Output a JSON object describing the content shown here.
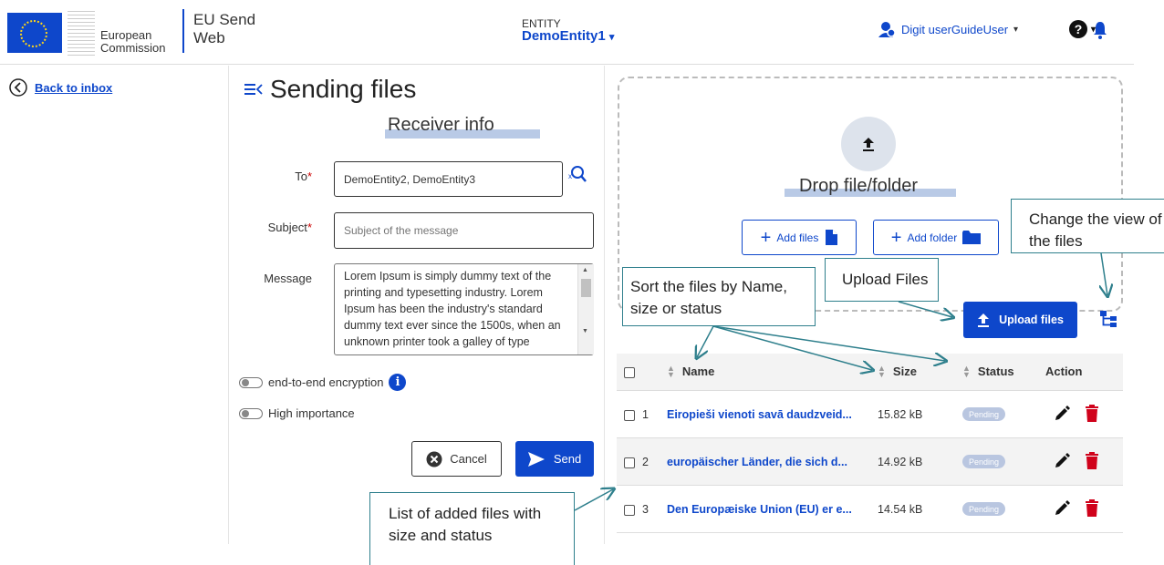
{
  "header": {
    "org_line1": "European",
    "org_line2": "Commission",
    "app_line1": "EU Send",
    "app_line2": "Web",
    "entity_label": "ENTITY",
    "entity_name": "DemoEntity1",
    "user_name": "Digit userGuideUser",
    "help_label": "?"
  },
  "nav": {
    "back_label": "Back to inbox"
  },
  "form": {
    "title": "Sending files",
    "section_title": "Receiver info",
    "to_label": "To",
    "to_value": "DemoEntity2, DemoEntity3",
    "subject_label": "Subject",
    "subject_placeholder": "Subject of the message",
    "message_label": "Message",
    "message_value": "Lorem Ipsum is simply dummy text of the printing and typesetting industry. Lorem Ipsum has been the industry's standard dummy text ever since the 1500s, when an unknown printer took a galley of type",
    "required_mark": "*",
    "encryption_label": "end-to-end encryption",
    "info_glyph": "i",
    "importance_label": "High importance",
    "cancel_label": "Cancel",
    "send_label": "Send"
  },
  "upload": {
    "drop_text": "Drop file/folder",
    "add_files_label": "Add files",
    "add_folder_label": "Add folder",
    "upload_label": "Upload files"
  },
  "table": {
    "headers": {
      "name": "Name",
      "size": "Size",
      "status": "Status",
      "action": "Action"
    },
    "rows": [
      {
        "num": "1",
        "name": "Eiropieši vienoti savā daudzveid...",
        "size": "15.82 kB",
        "status": "Pending"
      },
      {
        "num": "2",
        "name": "europäischer Länder, die sich d...",
        "size": "14.92 kB",
        "status": "Pending"
      },
      {
        "num": "3",
        "name": "Den Europæiske Union (EU) er e...",
        "size": "14.54 kB",
        "status": "Pending"
      }
    ]
  },
  "annotations": {
    "change_view": "Change the view of the files",
    "upload_files": "Upload Files",
    "sort_files": "Sort the files by Name, size or status",
    "list_files": "List of added files with size and status"
  },
  "colors": {
    "primary": "#0e47cb",
    "danger": "#d0021b",
    "annotation": "#2e7f8c"
  }
}
